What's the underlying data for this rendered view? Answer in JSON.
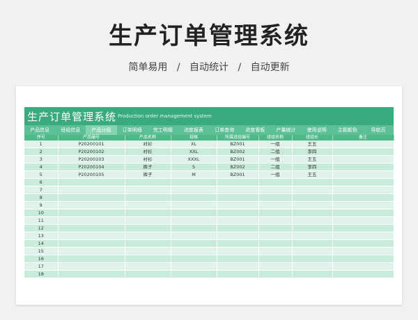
{
  "poster": {
    "title": "生产订单管理系统",
    "subtitle_parts": [
      "简单易用",
      "/",
      "自动统计",
      "/",
      "自动更新"
    ]
  },
  "sheet": {
    "title": "生产订单管理系统",
    "subtitle": "Production order management system",
    "tabs": [
      "产品信息",
      "班组信息",
      "产品分组",
      "订单明细",
      "完工明细",
      "进度报表",
      "订单查询",
      "进度看板",
      "产量统计",
      "使用说明",
      "主题颜色",
      "导航页"
    ],
    "active_tab_index": 2,
    "columns": [
      "序号",
      "产品编号",
      "产品名称",
      "规格",
      "所属班组编号",
      "班组名称",
      "班组长",
      "备注"
    ],
    "rows": [
      [
        "1",
        "P20200101",
        "衬衫",
        "XL",
        "BZ001",
        "一组",
        "王五",
        ""
      ],
      [
        "2",
        "P20200102",
        "衬衫",
        "XXL",
        "BZ002",
        "二组",
        "李四",
        ""
      ],
      [
        "3",
        "P20200103",
        "衬衫",
        "XXXL",
        "BZ001",
        "一组",
        "王五",
        ""
      ],
      [
        "4",
        "P20200104",
        "裤子",
        "S",
        "BZ002",
        "二组",
        "李四",
        ""
      ],
      [
        "5",
        "P20200105",
        "裤子",
        "M",
        "BZ001",
        "一组",
        "王五",
        ""
      ],
      [
        "6",
        "",
        "",
        "",
        "",
        "",
        "",
        ""
      ],
      [
        "7",
        "",
        "",
        "",
        "",
        "",
        "",
        ""
      ],
      [
        "8",
        "",
        "",
        "",
        "",
        "",
        "",
        ""
      ],
      [
        "9",
        "",
        "",
        "",
        "",
        "",
        "",
        ""
      ],
      [
        "10",
        "",
        "",
        "",
        "",
        "",
        "",
        ""
      ],
      [
        "11",
        "",
        "",
        "",
        "",
        "",
        "",
        ""
      ],
      [
        "12",
        "",
        "",
        "",
        "",
        "",
        "",
        ""
      ],
      [
        "13",
        "",
        "",
        "",
        "",
        "",
        "",
        ""
      ],
      [
        "14",
        "",
        "",
        "",
        "",
        "",
        "",
        ""
      ],
      [
        "15",
        "",
        "",
        "",
        "",
        "",
        "",
        ""
      ],
      [
        "16",
        "",
        "",
        "",
        "",
        "",
        "",
        ""
      ],
      [
        "17",
        "",
        "",
        "",
        "",
        "",
        "",
        ""
      ],
      [
        "18",
        "",
        "",
        "",
        "",
        "",
        "",
        ""
      ]
    ]
  },
  "colors": {
    "header": "#3aab7f",
    "tab_bar": "#5cbf96",
    "active_tab": "#86d3b1",
    "column_header": "#4db888",
    "row_light": "#dff3ea",
    "row_dark": "#c9ebdb"
  }
}
